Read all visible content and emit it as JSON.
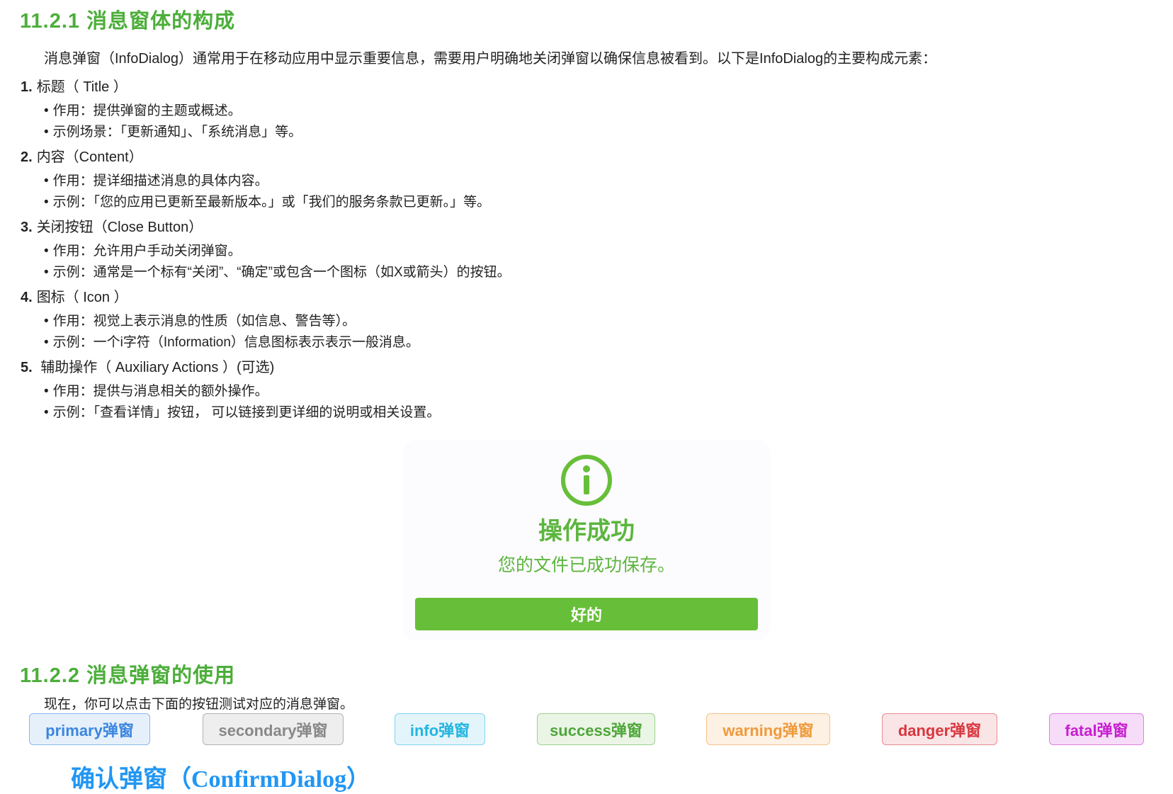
{
  "section1": {
    "heading": "11.2.1 消息窗体的构成",
    "intro": "消息弹窗（InfoDialog）通常用于在移动应用中显示重要信息，需要用户明确地关闭弹窗以确保信息被看到。以下是InfoDialog的主要构成元素：",
    "items": [
      {
        "num": "1.",
        "title": "标题（ Title ）",
        "bullets": [
          "作用：提供弹窗的主题或概述。",
          "示例场景：「更新通知」、「系统消息」等。"
        ]
      },
      {
        "num": "2.",
        "title": "内容（Content）",
        "bullets": [
          "作用：提详细描述消息的具体内容。",
          "示例：「您的应用已更新至最新版本。」或「我们的服务条款已更新。」等。"
        ]
      },
      {
        "num": "3.",
        "title": "关闭按钮（Close Button）",
        "bullets": [
          "作用：允许用户手动关闭弹窗。",
          "示例：通常是一个标有“关闭”、“确定”或包含一个图标（如X或箭头）的按钮。"
        ]
      },
      {
        "num": "4.",
        "title": "图标（ Icon ）",
        "bullets": [
          "作用：视觉上表示消息的性质（如信息、警告等）。",
          "示例：一个i字符（Information）信息图标表示表示一般消息。"
        ]
      },
      {
        "num": "5.",
        "title": " 辅助操作（ Auxiliary Actions ）(可选)",
        "bullets": [
          "作用：提供与消息相关的额外操作。",
          "示例：「查看详情」按钮，  可以链接到更详细的说明或相关设置。"
        ]
      }
    ]
  },
  "dialog": {
    "icon": "info-circle-icon",
    "title": "操作成功",
    "message": "您的文件已成功保存。",
    "button": "好的",
    "accent": "#67bf39"
  },
  "section2": {
    "heading": "11.2.2 消息弹窗的使用",
    "intro": "现在，你可以点击下面的按钮测试对应的消息弹窗。",
    "buttons": [
      {
        "label": "primary弹窗",
        "color": "#3a86e0"
      },
      {
        "label": "secondary弹窗",
        "color": "#888888"
      },
      {
        "label": "info弹窗",
        "color": "#22b5e0"
      },
      {
        "label": "success弹窗",
        "color": "#4fa63a"
      },
      {
        "label": "warning弹窗",
        "color": "#ef9a3a"
      },
      {
        "label": "danger弹窗",
        "color": "#d9363e"
      },
      {
        "label": "fatal弹窗",
        "color": "#c61fd0"
      }
    ]
  },
  "next_heading": "确认弹窗（ConfirmDialog）"
}
